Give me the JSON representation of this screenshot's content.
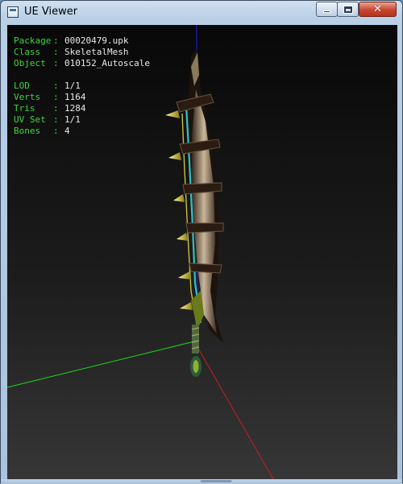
{
  "window": {
    "title": "UE Viewer",
    "minimize_icon": "minimize-icon",
    "maximize_icon": "maximize-icon",
    "close_symbol": "✕"
  },
  "info": {
    "package_label": "Package",
    "package_value": "00020479.upk",
    "class_label": "Class",
    "class_value": "SkeletalMesh",
    "object_label": "Object",
    "object_value": "010152_Autoscale",
    "lod_label": "LOD",
    "lod_value": "1/1",
    "verts_label": "Verts",
    "verts_value": "1164",
    "tris_label": "Tris",
    "tris_value": "1284",
    "uvset_label": "UV Set",
    "uvset_value": "1/1",
    "bones_label": "Bones",
    "bones_value": "4",
    "separator": ":"
  },
  "colors": {
    "label_green": "#3fd43f",
    "axis_x": "#c62020",
    "axis_y": "#1fd91f",
    "axis_z": "#1a1ad8"
  }
}
